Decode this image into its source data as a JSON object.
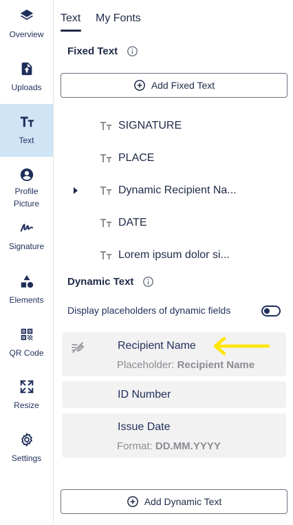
{
  "sidebar": {
    "items": [
      {
        "label": "Overview",
        "icon": "layers-icon"
      },
      {
        "label": "Uploads",
        "icon": "upload-file-icon"
      },
      {
        "label": "Text",
        "icon": "text-tt-icon",
        "active": true
      },
      {
        "label": "Profile Picture",
        "icon": "account-circle-icon"
      },
      {
        "label": "Signature",
        "icon": "signature-icon"
      },
      {
        "label": "Elements",
        "icon": "shapes-icon"
      },
      {
        "label": "QR Code",
        "icon": "qr-code-icon"
      },
      {
        "label": "Resize",
        "icon": "resize-icon"
      },
      {
        "label": "Settings",
        "icon": "gear-icon"
      }
    ]
  },
  "tabs": {
    "text": "Text",
    "my_fonts": "My Fonts",
    "active": "Text"
  },
  "fixed_text": {
    "title": "Fixed Text",
    "add_label": "Add Fixed Text",
    "items": [
      {
        "label": "SIGNATURE"
      },
      {
        "label": "PLACE"
      },
      {
        "label": "Dynamic Recipient Na...",
        "expandable": true
      },
      {
        "label": "DATE"
      },
      {
        "label": "Lorem ipsum dolor si..."
      }
    ]
  },
  "dynamic_text": {
    "title": "Dynamic Text",
    "toggle_label": "Display placeholders of dynamic fields",
    "toggle_on": false,
    "add_label": "Add Dynamic Text",
    "items": [
      {
        "name": "Recipient Name",
        "sub_key": "Placeholder:",
        "sub_value": "Recipient Name"
      },
      {
        "name": "ID Number"
      },
      {
        "name": "Issue Date",
        "sub_key": "Format:",
        "sub_value": "DD.MM.YYYY"
      }
    ]
  },
  "colors": {
    "navy": "#1e2a47",
    "active_bg": "#cfe5f5",
    "card_bg": "#f2f2f2",
    "highlight_arrow": "#ffe500"
  }
}
